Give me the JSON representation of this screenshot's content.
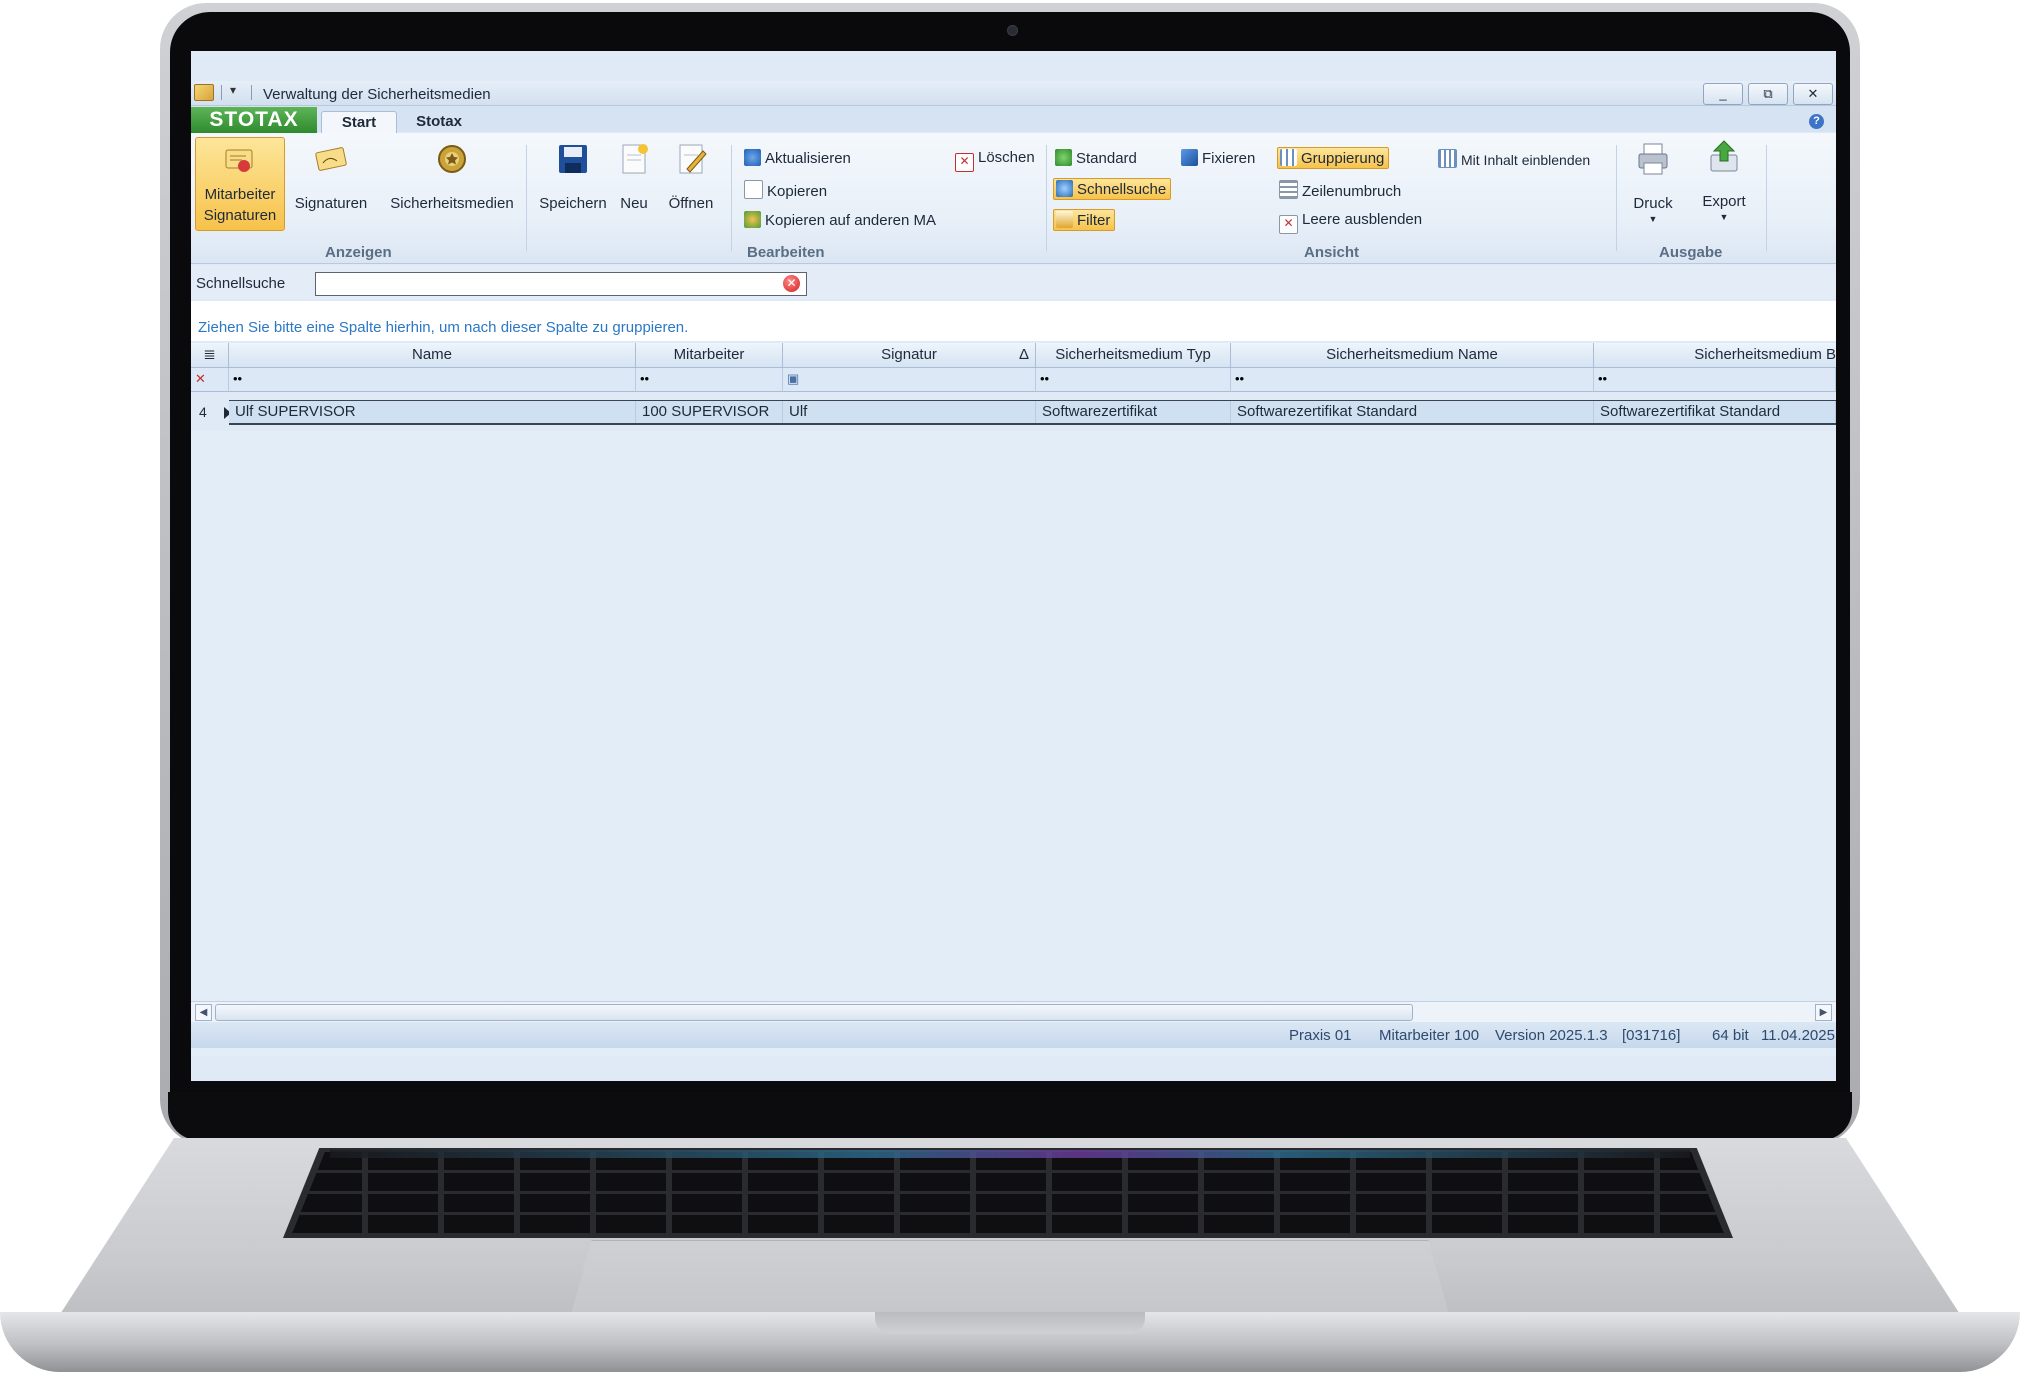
{
  "window": {
    "title": "Verwaltung der Sicherheitsmedien",
    "minimize": "_",
    "restore": "⧉",
    "close": "✕"
  },
  "ribbon": {
    "brand": "STOTAX",
    "tabs": [
      "Start",
      "Stotax"
    ],
    "active_tab": "Start",
    "help": "?",
    "anzeigen": {
      "group_label": "Anzeigen",
      "mitarbeiter_signaturen_line1": "Mitarbeiter",
      "mitarbeiter_signaturen_line2": "Signaturen",
      "signaturen": "Signaturen",
      "sicherheitsmedien": "Sicherheitsmedien"
    },
    "datei": {
      "speichern": "Speichern",
      "neu": "Neu",
      "oeffnen": "Öffnen"
    },
    "bearbeiten": {
      "group_label": "Bearbeiten",
      "aktualisieren": "Aktualisieren",
      "kopieren": "Kopieren",
      "kopieren_ma": "Kopieren auf anderen MA",
      "loeschen": "Löschen"
    },
    "ansicht": {
      "group_label": "Ansicht",
      "standard": "Standard",
      "schnellsuche": "Schnellsuche",
      "filter": "Filter",
      "fixieren": "Fixieren",
      "gruppierung": "Gruppierung",
      "zeilenumbruch": "Zeilenumbruch",
      "leere_ausblenden": "Leere ausblenden",
      "mit_inhalt": "Mit Inhalt einblenden"
    },
    "ausgabe": {
      "group_label": "Ausgabe",
      "druck": "Druck",
      "export": "Export"
    }
  },
  "search": {
    "label": "Schnellsuche",
    "value": ""
  },
  "grid": {
    "group_hint": "Ziehen Sie bitte eine Spalte hierhin, um nach dieser Spalte zu gruppieren.",
    "columns": [
      "Name",
      "Mitarbeiter",
      "Signatur",
      "Sicherheitsmedium Typ",
      "Sicherheitsmedium Name",
      "Sicherheitsmedium B"
    ],
    "sort_indicator": "Δ",
    "filter_placeholder": "••",
    "rows": [
      {
        "num": "4",
        "cells": [
          "Ulf SUPERVISOR",
          "100 SUPERVISOR",
          "Ulf",
          "Softwarezertifikat",
          "Softwarezertifikat Standard",
          "Softwarezertifikat Standard"
        ]
      }
    ]
  },
  "status": {
    "praxis": "Praxis 01",
    "mitarbeiter": "Mitarbeiter 100",
    "version": "Version 2025.1.3",
    "build": "[031716]",
    "bits": "64 bit",
    "date": "11.04.2025"
  },
  "colors": {
    "brand": "#3a9a3a",
    "highlight": "#f7c24a",
    "hint_text": "#2c78c6"
  }
}
